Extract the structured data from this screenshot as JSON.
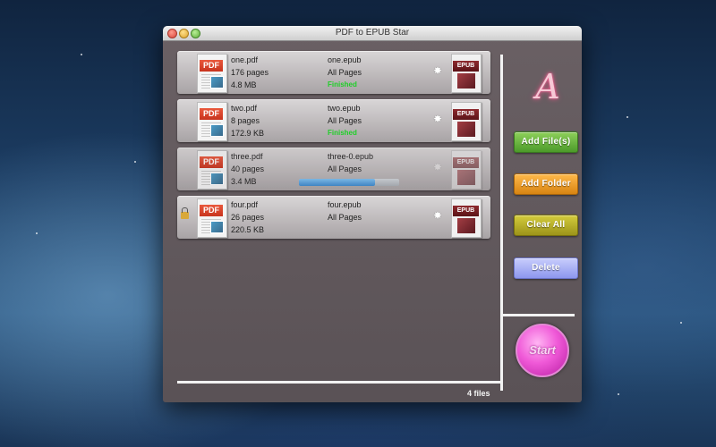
{
  "window": {
    "title": "PDF to EPUB Star"
  },
  "files": [
    {
      "name": "one.pdf",
      "pages": "176 pages",
      "size": "4.8 MB",
      "output": "one.epub",
      "range": "All Pages",
      "status": "Finished"
    },
    {
      "name": "two.pdf",
      "pages": "8 pages",
      "size": "172.9 KB",
      "output": "two.epub",
      "range": "All Pages",
      "status": "Finished"
    },
    {
      "name": "three.pdf",
      "pages": "40 pages",
      "size": "3.4 MB",
      "output": "three-0.epub",
      "range": "All Pages",
      "status": "",
      "progress": 0.76
    },
    {
      "name": "four.pdf",
      "pages": "26 pages",
      "size": "220.5 KB",
      "output": "four.epub",
      "range": "All Pages",
      "status": "",
      "locked": true
    }
  ],
  "icons": {
    "pdf_label": "PDF",
    "epub_label": "EPUB"
  },
  "buttons": {
    "add_files": "Add File(s)",
    "add_folder": "Add Folder",
    "clear_all": "Clear All",
    "delete": "Delete",
    "start": "Start"
  },
  "status_bar": {
    "file_count": "4 files"
  },
  "colors": {
    "finished": "#1fcf28",
    "add_files": "#6cb840",
    "add_folder": "#f0a22e",
    "clear_all": "#bdb42a",
    "delete": "#a9b1f5",
    "start": "#f05ad8"
  }
}
